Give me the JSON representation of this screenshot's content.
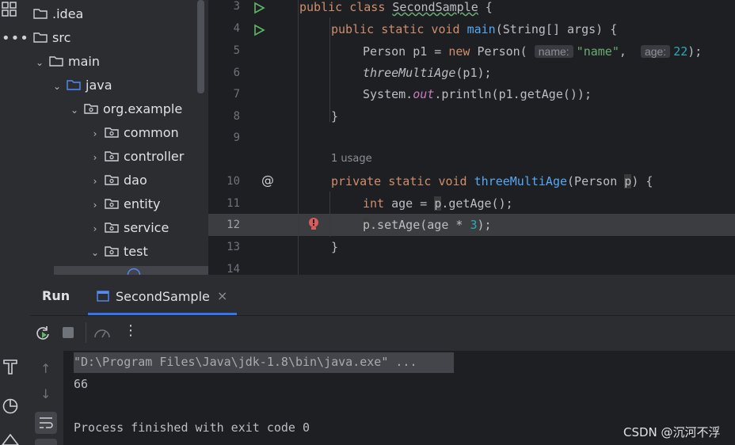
{
  "project_tree": [
    {
      "label": ".idea",
      "expanded": false,
      "arrow": false
    },
    {
      "label": "src",
      "expanded": false,
      "arrow": false
    },
    {
      "label": "main",
      "expanded": true,
      "arrow": true
    },
    {
      "label": "java",
      "expanded": true,
      "arrow": true
    },
    {
      "label": "org.example",
      "expanded": true,
      "arrow": true
    },
    {
      "label": "common",
      "expanded": false,
      "arrow": true
    },
    {
      "label": "controller",
      "expanded": false,
      "arrow": true
    },
    {
      "label": "dao",
      "expanded": false,
      "arrow": true
    },
    {
      "label": "entity",
      "expanded": false,
      "arrow": true
    },
    {
      "label": "service",
      "expanded": false,
      "arrow": true
    },
    {
      "label": "test",
      "expanded": true,
      "arrow": true
    },
    {
      "label": "",
      "expanded": false,
      "arrow": false
    }
  ],
  "editor": {
    "line_numbers": [
      "3",
      "4",
      "5",
      "6",
      "7",
      "8",
      "9",
      "10",
      "11",
      "12",
      "13",
      "14"
    ],
    "usage_hint": "1 usage",
    "hints": {
      "name": "name:",
      "age": "age:"
    },
    "current_line": "12"
  },
  "run_panel": {
    "run_label": "Run",
    "tab_label": "SecondSample",
    "command_line": "\"D:\\Program Files\\Java\\jdk-1.8\\bin\\java.exe\" ...",
    "output_value": "66",
    "exit_message": "Process finished with exit code 0"
  },
  "watermark": "CSDN @沉河不浮",
  "colors": {
    "accent": "#3574f0",
    "keyword": "#cf8e6d",
    "function": "#56a8f5",
    "string": "#6aab73",
    "number": "#2aacb8",
    "error": "#db5c5c",
    "run_green": "#5fb865"
  }
}
